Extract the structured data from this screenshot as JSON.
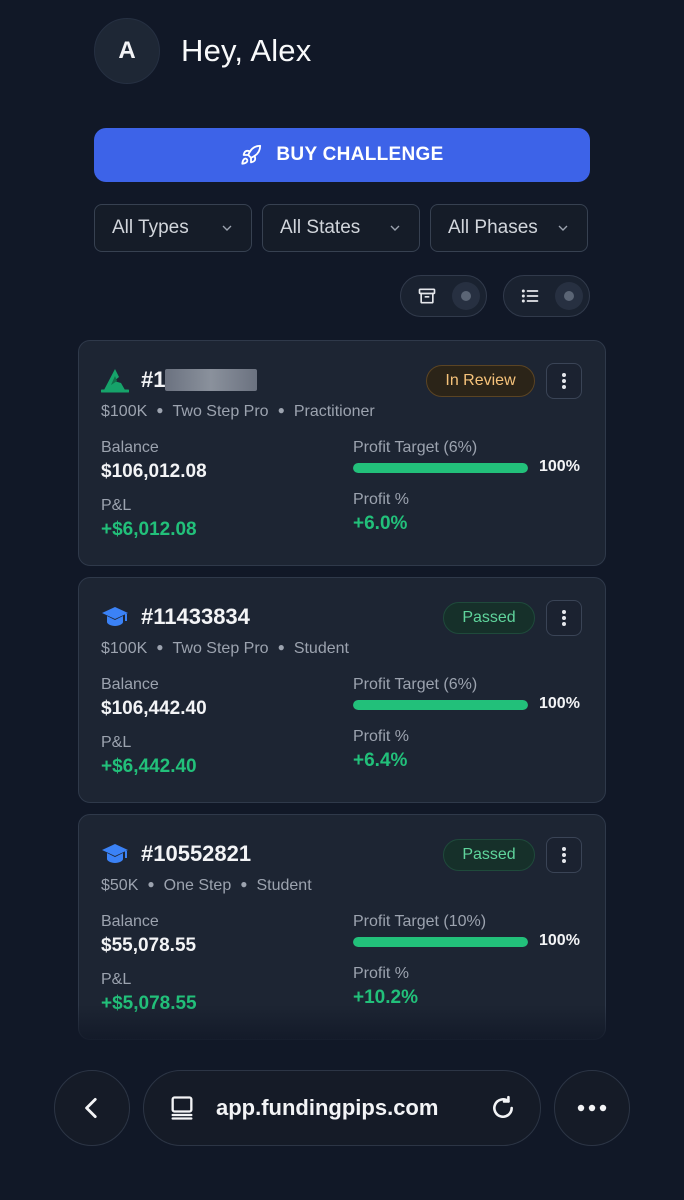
{
  "user": {
    "avatar_initial": "A",
    "greeting": "Hey, Alex"
  },
  "buy_button": {
    "label": "BUY CHALLENGE",
    "icon": "rocket-icon"
  },
  "filters": [
    {
      "label": "All Types"
    },
    {
      "label": "All States"
    },
    {
      "label": "All Phases"
    }
  ],
  "toggles": [
    {
      "icon": "archive-icon"
    },
    {
      "icon": "list-icon"
    }
  ],
  "accounts": [
    {
      "icon": "wizard-hat-icon",
      "id": "#1",
      "id_redacted": true,
      "size": "$100K",
      "program": "Two Step Pro",
      "level": "Practitioner",
      "status": "In Review",
      "balance_label": "Balance",
      "balance": "$106,012.08",
      "pnl_label": "P&L",
      "pnl": "+$6,012.08",
      "target_label": "Profit Target (6%)",
      "target_progress": 1.0,
      "target_pct": "100%",
      "profit_label": "Profit %",
      "profit": "+6.0%"
    },
    {
      "icon": "graduation-cap-icon",
      "id": "#11433834",
      "size": "$100K",
      "program": "Two Step Pro",
      "level": "Student",
      "status": "Passed",
      "balance_label": "Balance",
      "balance": "$106,442.40",
      "pnl_label": "P&L",
      "pnl": "+$6,442.40",
      "target_label": "Profit Target (6%)",
      "target_progress": 1.0,
      "target_pct": "100%",
      "profit_label": "Profit %",
      "profit": "+6.4%"
    },
    {
      "icon": "graduation-cap-icon",
      "id": "#10552821",
      "size": "$50K",
      "program": "One Step",
      "level": "Student",
      "status": "Passed",
      "balance_label": "Balance",
      "balance": "$55,078.55",
      "pnl_label": "P&L",
      "pnl": "+$5,078.55",
      "target_label": "Profit Target (10%)",
      "target_progress": 1.0,
      "target_pct": "100%",
      "profit_label": "Profit %",
      "profit": "+10.2%"
    }
  ],
  "browser": {
    "url": "app.fundingpips.com"
  },
  "colors": {
    "accent": "#3d63e8",
    "positive": "#22c07a",
    "review": "#f5c27a",
    "background": "#111827"
  }
}
